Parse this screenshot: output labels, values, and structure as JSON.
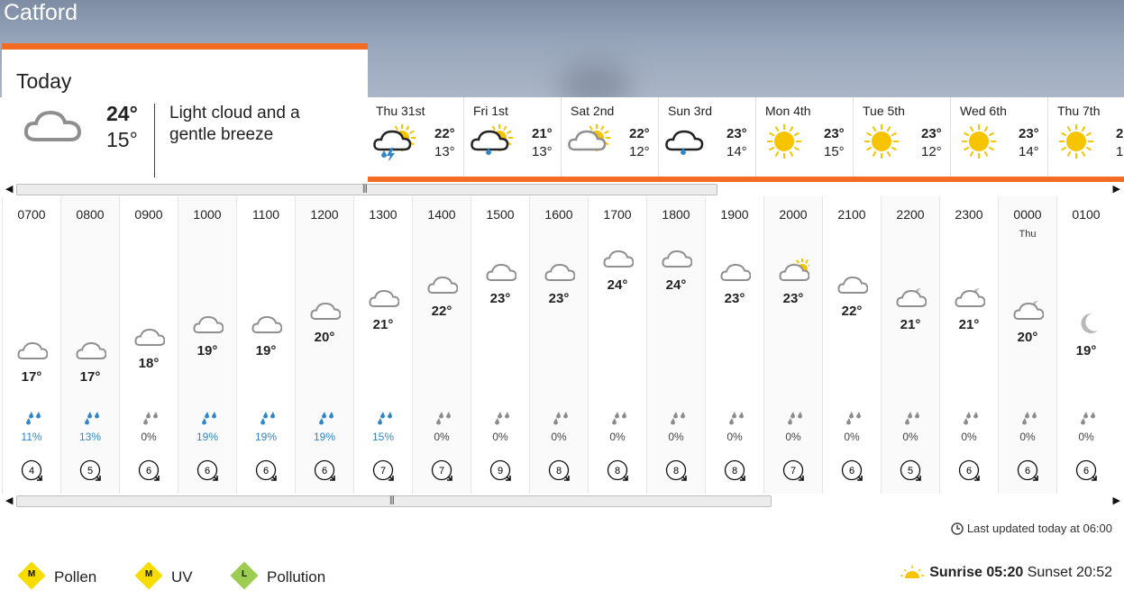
{
  "location": "Catford",
  "colors": {
    "accent": "#f36c23",
    "rain": "#2f86c9",
    "sun": "#f6c400",
    "cloud": "#8f8f8f"
  },
  "today": {
    "title": "Today",
    "high": "24°",
    "low": "15°",
    "description": "Light cloud and a gentle breeze",
    "icon": "light-cloud"
  },
  "days": [
    {
      "label": "Thu 31st",
      "high": "22°",
      "low": "13°",
      "icon": "thunder-sun-cloud"
    },
    {
      "label": "Fri 1st",
      "high": "21°",
      "low": "13°",
      "icon": "rain-sun-cloud"
    },
    {
      "label": "Sat 2nd",
      "high": "22°",
      "low": "12°",
      "icon": "sun-cloud"
    },
    {
      "label": "Sun 3rd",
      "high": "23°",
      "low": "14°",
      "icon": "rain-cloud"
    },
    {
      "label": "Mon 4th",
      "high": "23°",
      "low": "15°",
      "icon": "sun"
    },
    {
      "label": "Tue 5th",
      "high": "23°",
      "low": "12°",
      "icon": "sun"
    },
    {
      "label": "Wed 6th",
      "high": "23°",
      "low": "14°",
      "icon": "sun"
    },
    {
      "label": "Thu 7th",
      "high": "2",
      "low": "1",
      "icon": "sun"
    }
  ],
  "hours": [
    {
      "time": "0700",
      "sub": "",
      "temp": 17,
      "temp_label": "17°",
      "icon": "cloud",
      "rain": "11%",
      "rain_on": true,
      "wind": "4"
    },
    {
      "time": "0800",
      "sub": "",
      "temp": 17,
      "temp_label": "17°",
      "icon": "cloud",
      "rain": "13%",
      "rain_on": true,
      "wind": "5"
    },
    {
      "time": "0900",
      "sub": "",
      "temp": 18,
      "temp_label": "18°",
      "icon": "cloud",
      "rain": "0%",
      "rain_on": false,
      "wind": "6"
    },
    {
      "time": "1000",
      "sub": "",
      "temp": 19,
      "temp_label": "19°",
      "icon": "cloud",
      "rain": "19%",
      "rain_on": true,
      "wind": "6"
    },
    {
      "time": "1100",
      "sub": "",
      "temp": 19,
      "temp_label": "19°",
      "icon": "cloud",
      "rain": "19%",
      "rain_on": true,
      "wind": "6"
    },
    {
      "time": "1200",
      "sub": "",
      "temp": 20,
      "temp_label": "20°",
      "icon": "cloud",
      "rain": "19%",
      "rain_on": true,
      "wind": "6"
    },
    {
      "time": "1300",
      "sub": "",
      "temp": 21,
      "temp_label": "21°",
      "icon": "cloud",
      "rain": "15%",
      "rain_on": true,
      "wind": "7"
    },
    {
      "time": "1400",
      "sub": "",
      "temp": 22,
      "temp_label": "22°",
      "icon": "cloud",
      "rain": "0%",
      "rain_on": false,
      "wind": "7"
    },
    {
      "time": "1500",
      "sub": "",
      "temp": 23,
      "temp_label": "23°",
      "icon": "cloud",
      "rain": "0%",
      "rain_on": false,
      "wind": "9"
    },
    {
      "time": "1600",
      "sub": "",
      "temp": 23,
      "temp_label": "23°",
      "icon": "cloud",
      "rain": "0%",
      "rain_on": false,
      "wind": "8"
    },
    {
      "time": "1700",
      "sub": "",
      "temp": 24,
      "temp_label": "24°",
      "icon": "cloud",
      "rain": "0%",
      "rain_on": false,
      "wind": "8"
    },
    {
      "time": "1800",
      "sub": "",
      "temp": 24,
      "temp_label": "24°",
      "icon": "cloud",
      "rain": "0%",
      "rain_on": false,
      "wind": "8"
    },
    {
      "time": "1900",
      "sub": "",
      "temp": 23,
      "temp_label": "23°",
      "icon": "cloud",
      "rain": "0%",
      "rain_on": false,
      "wind": "8"
    },
    {
      "time": "2000",
      "sub": "",
      "temp": 23,
      "temp_label": "23°",
      "icon": "sun-cloud",
      "rain": "0%",
      "rain_on": false,
      "wind": "7"
    },
    {
      "time": "2100",
      "sub": "",
      "temp": 22,
      "temp_label": "22°",
      "icon": "cloud",
      "rain": "0%",
      "rain_on": false,
      "wind": "6"
    },
    {
      "time": "2200",
      "sub": "",
      "temp": 21,
      "temp_label": "21°",
      "icon": "moon-cloud",
      "rain": "0%",
      "rain_on": false,
      "wind": "5"
    },
    {
      "time": "2300",
      "sub": "",
      "temp": 21,
      "temp_label": "21°",
      "icon": "moon-cloud",
      "rain": "0%",
      "rain_on": false,
      "wind": "6"
    },
    {
      "time": "0000",
      "sub": "Thu",
      "temp": 20,
      "temp_label": "20°",
      "icon": "moon-cloud",
      "rain": "0%",
      "rain_on": false,
      "wind": "6"
    },
    {
      "time": "0100",
      "sub": "",
      "temp": 19,
      "temp_label": "19°",
      "icon": "moon",
      "rain": "0%",
      "rain_on": false,
      "wind": "6"
    }
  ],
  "footer": {
    "updated": "Last updated today at 06:00",
    "pollen": {
      "level": "M",
      "label": "Pollen",
      "color": "#f6dc00"
    },
    "uv": {
      "level": "M",
      "label": "UV",
      "color": "#f6dc00"
    },
    "pollution": {
      "level": "L",
      "label": "Pollution",
      "color": "#9ccc50"
    },
    "sunrise": "Sunrise 05:20",
    "sunset": "Sunset 20:52"
  }
}
